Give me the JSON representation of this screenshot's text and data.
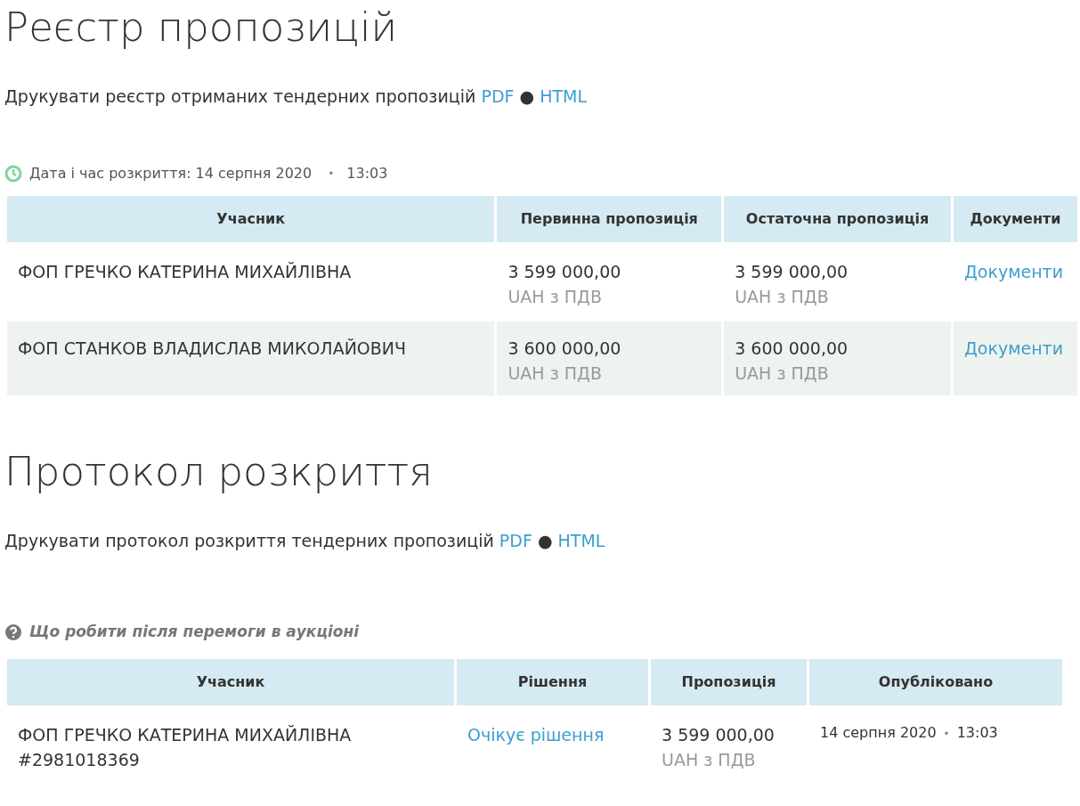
{
  "registry": {
    "title": "Реєстр пропозицій",
    "print_text": "Друкувати реєстр отриманих тендерних пропозицій",
    "links": [
      "PDF",
      "HTML"
    ],
    "link_separator": "●",
    "opening": {
      "label": "Дата і час розкриття: 14 серпня 2020",
      "separator": "•",
      "time": "13:03"
    },
    "columns": [
      "Учасник",
      "Первинна пропозиція",
      "Остаточна пропозиція",
      "Документи"
    ],
    "rows": [
      {
        "participant": "ФОП ГРЕЧКО КАТЕРИНА МИХАЙЛІВНА",
        "initial": "3 599 000,00",
        "initial_note": "UAH з ПДВ",
        "final": "3 599 000,00",
        "final_note": "UAH з ПДВ",
        "documents": "Документи"
      },
      {
        "participant": "ФОП СТАНКОВ ВЛАДИСЛАВ МИКОЛАЙОВИЧ",
        "initial": "3 600 000,00",
        "initial_note": "UAH з ПДВ",
        "final": "3 600 000,00",
        "final_note": "UAH з ПДВ",
        "documents": "Документи"
      }
    ]
  },
  "protocol": {
    "title": "Протокол розкриття",
    "print_text": "Друкувати протокол розкриття тендерних пропозицій",
    "links": [
      "PDF",
      "HTML"
    ],
    "link_separator": "●",
    "help": "Що робити після перемоги в аукціоні",
    "columns": [
      "Учасник",
      "Рішення",
      "Пропозиція",
      "Опубліковано"
    ],
    "rows": [
      {
        "participant": "ФОП ГРЕЧКО КАТЕРИНА МИХАЙЛІВНА",
        "participant_id": "#2981018369",
        "decision": "Очікує рішення",
        "offer": "3 599 000,00",
        "offer_note": "UAH з ПДВ",
        "published_date": "14 серпня 2020",
        "separator": "•",
        "published_time": "13:03"
      }
    ]
  }
}
